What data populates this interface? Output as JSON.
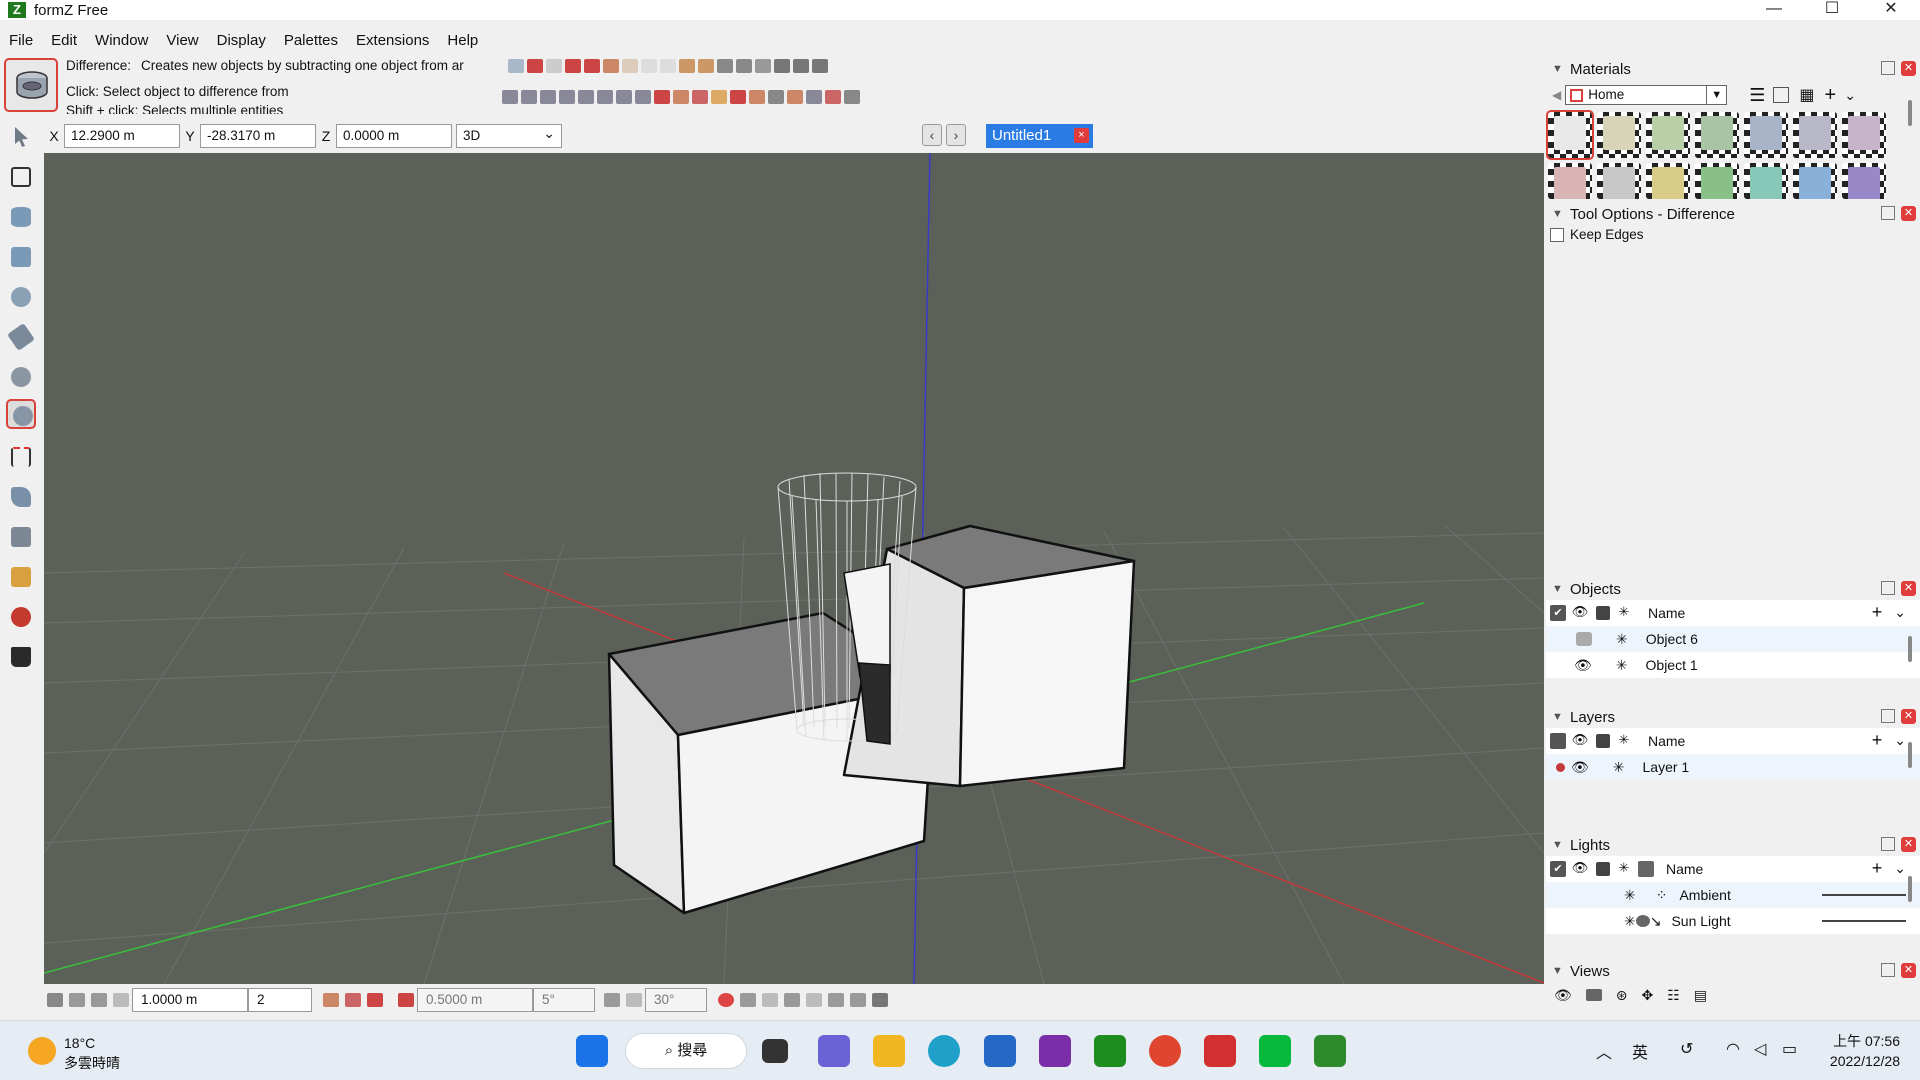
{
  "window": {
    "title": "formZ Free",
    "controls": [
      "—",
      "☐",
      "✕"
    ]
  },
  "menu": [
    "File",
    "Edit",
    "Window",
    "View",
    "Display",
    "Palettes",
    "Extensions",
    "Help"
  ],
  "tool_info": {
    "name_label": "Difference:",
    "description": "Creates new objects by subtracting one object from ar",
    "click_hint": "Click: Select object to difference from",
    "shift_hint": "Shift + click: Selects multiple entities"
  },
  "coords": {
    "x_label": "X",
    "x_value": "12.2900 m",
    "y_label": "Y",
    "y_value": "-28.3170 m",
    "z_label": "Z",
    "z_value": "0.0000 m",
    "view_mode": "3D"
  },
  "document_tab": {
    "label": "Untitled1",
    "close": "×"
  },
  "bottom_strip": {
    "grid_size": "1.0000 m",
    "grid_divisions": "2",
    "snap_distance": "0.5000 m",
    "angle_step": "5°",
    "angle_snap": "30°"
  },
  "materials": {
    "title": "Materials",
    "library": "Home",
    "swatch_colors": [
      "#e8e8e8",
      "#d8d4b8",
      "#b8cfa8",
      "#a8c4a4",
      "#a8b4c8",
      "#b8b8c8",
      "#c8b4c8",
      "#d8b4b4",
      "#c8c8c8",
      "#d8cc88",
      "#88c088",
      "#88c8b8",
      "#88b0d8",
      "#9888c8"
    ]
  },
  "tool_options": {
    "title": "Tool Options - Difference",
    "keep_edges": "Keep Edges"
  },
  "objects": {
    "title": "Objects",
    "header_name": "Name",
    "rows": [
      {
        "name": "Object 6"
      },
      {
        "name": "Object 1"
      }
    ]
  },
  "layers": {
    "title": "Layers",
    "header_name": "Name",
    "rows": [
      {
        "name": "Layer 1"
      }
    ]
  },
  "lights": {
    "title": "Lights",
    "header_name": "Name",
    "rows": [
      {
        "name": "Ambient"
      },
      {
        "name": "Sun Light"
      }
    ]
  },
  "views": {
    "title": "Views"
  },
  "taskbar": {
    "temperature": "18°C",
    "weather": "多雲時晴",
    "search_label": "搜尋",
    "ime": "英",
    "time": "上午 07:56",
    "date": "2022/12/28"
  }
}
